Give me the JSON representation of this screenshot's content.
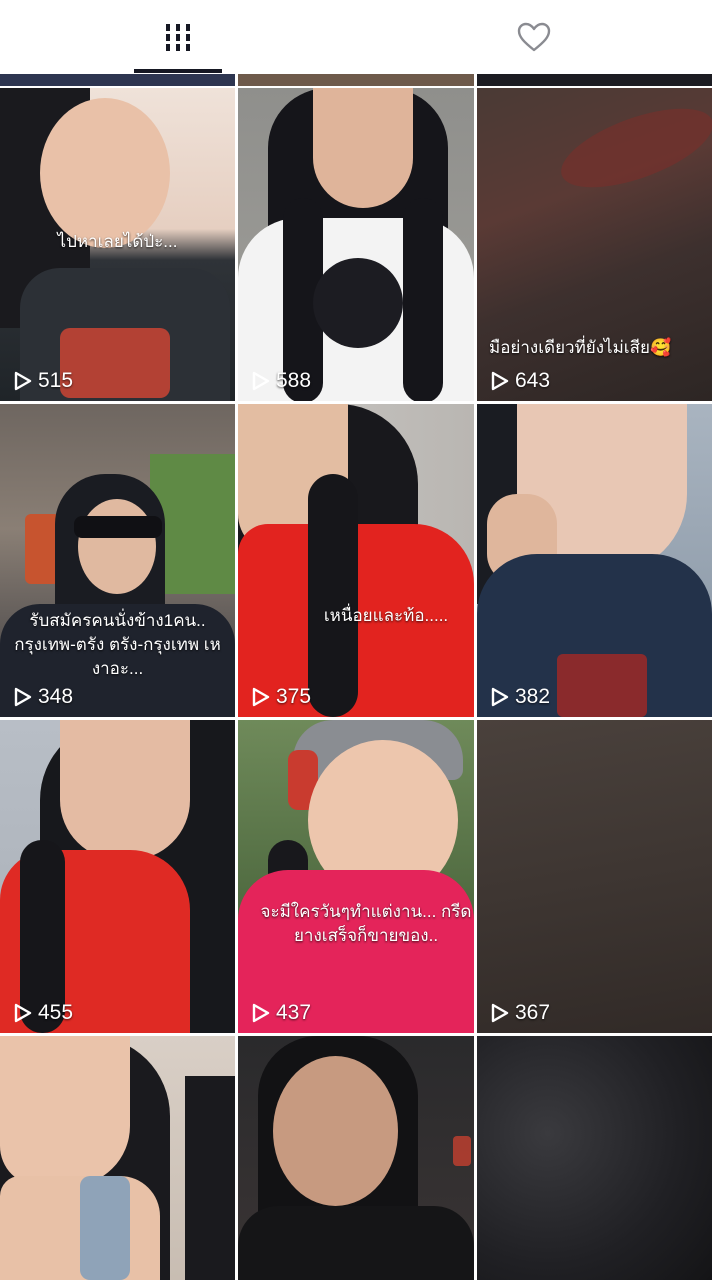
{
  "tabs": {
    "videos_icon": "grid-icon",
    "liked_icon": "heart-outline-icon"
  },
  "videos": [
    {
      "views": "515",
      "caption": "ไปหาเลยได้ป่ะ..."
    },
    {
      "views": "588",
      "caption": ""
    },
    {
      "views": "643",
      "caption": "มือย่างเดียวที่ยังไม่เสีย🥰"
    },
    {
      "views": "348",
      "caption": "รับสมัครคนนั่งข้าง1คน.. กรุงเทพ-ตรัง ตรัง-กรุงเทพ เหงาอะ..."
    },
    {
      "views": "375",
      "caption": "เหนื่อยและท้อ....."
    },
    {
      "views": "382",
      "caption": ""
    },
    {
      "views": "455",
      "caption": ""
    },
    {
      "views": "437",
      "caption": "จะมีใครวันๆทำแต่งาน... กรีดยางเสร็จก็ขายของ.."
    },
    {
      "views": "367",
      "caption": ""
    },
    {
      "views": "",
      "caption": ""
    },
    {
      "views": "",
      "caption": ""
    },
    {
      "views": "",
      "caption": ""
    }
  ]
}
